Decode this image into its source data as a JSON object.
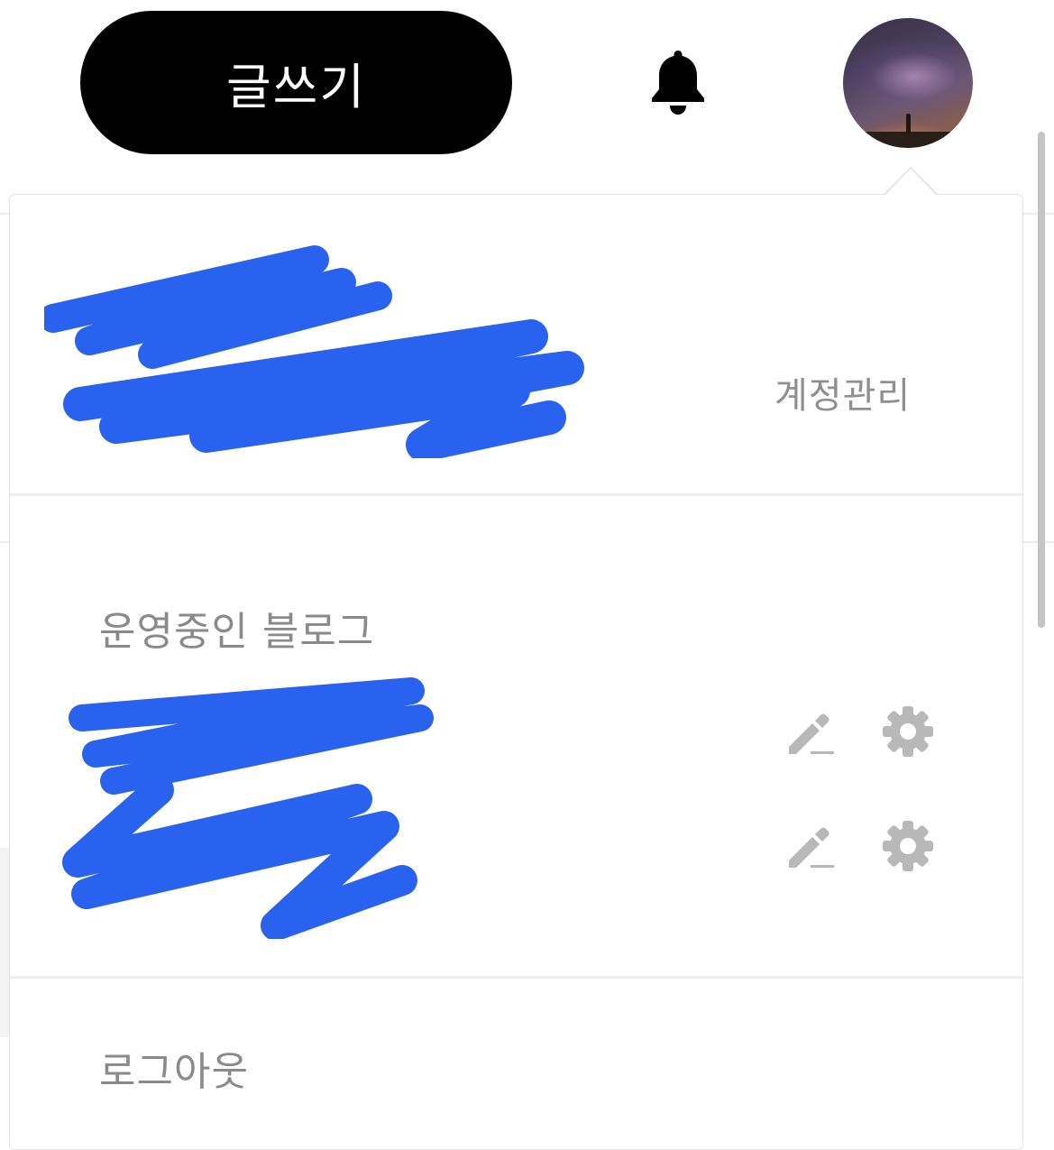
{
  "header": {
    "write_label": "글쓰기",
    "bell_icon": "bell-icon",
    "avatar_icon": "avatar"
  },
  "dropdown": {
    "account_manage_label": "계정관리",
    "blogs_section_title": "운영중인 블로그",
    "blogs": [
      {
        "edit_icon": "pencil-icon",
        "settings_icon": "gear-icon"
      },
      {
        "edit_icon": "pencil-icon",
        "settings_icon": "gear-icon"
      }
    ],
    "logout_label": "로그아웃"
  },
  "colors": {
    "write_button_bg": "#000000",
    "redaction": "#2962ee",
    "muted_text": "#8f8f8f",
    "icon_gray": "#b8b8b8"
  }
}
